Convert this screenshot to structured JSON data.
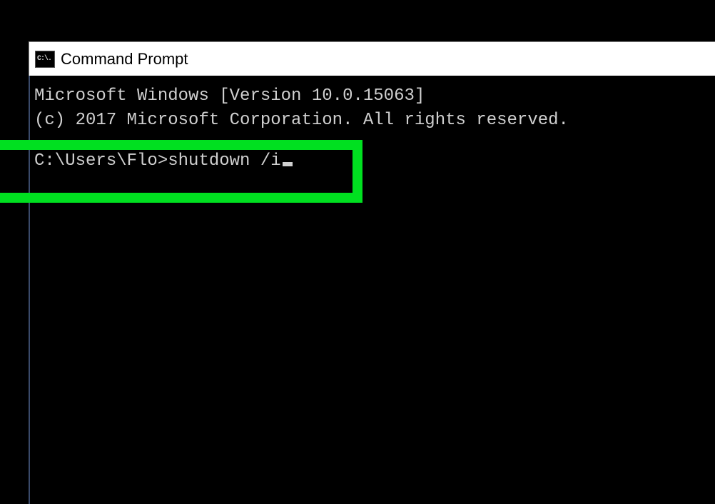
{
  "window": {
    "title": "Command Prompt",
    "icon_label": "C:\\."
  },
  "terminal": {
    "line1": "Microsoft Windows [Version 10.0.15063]",
    "line2": "(c) 2017 Microsoft Corporation. All rights reserved.",
    "prompt": "C:\\Users\\Flo>",
    "command": "shutdown /i"
  }
}
